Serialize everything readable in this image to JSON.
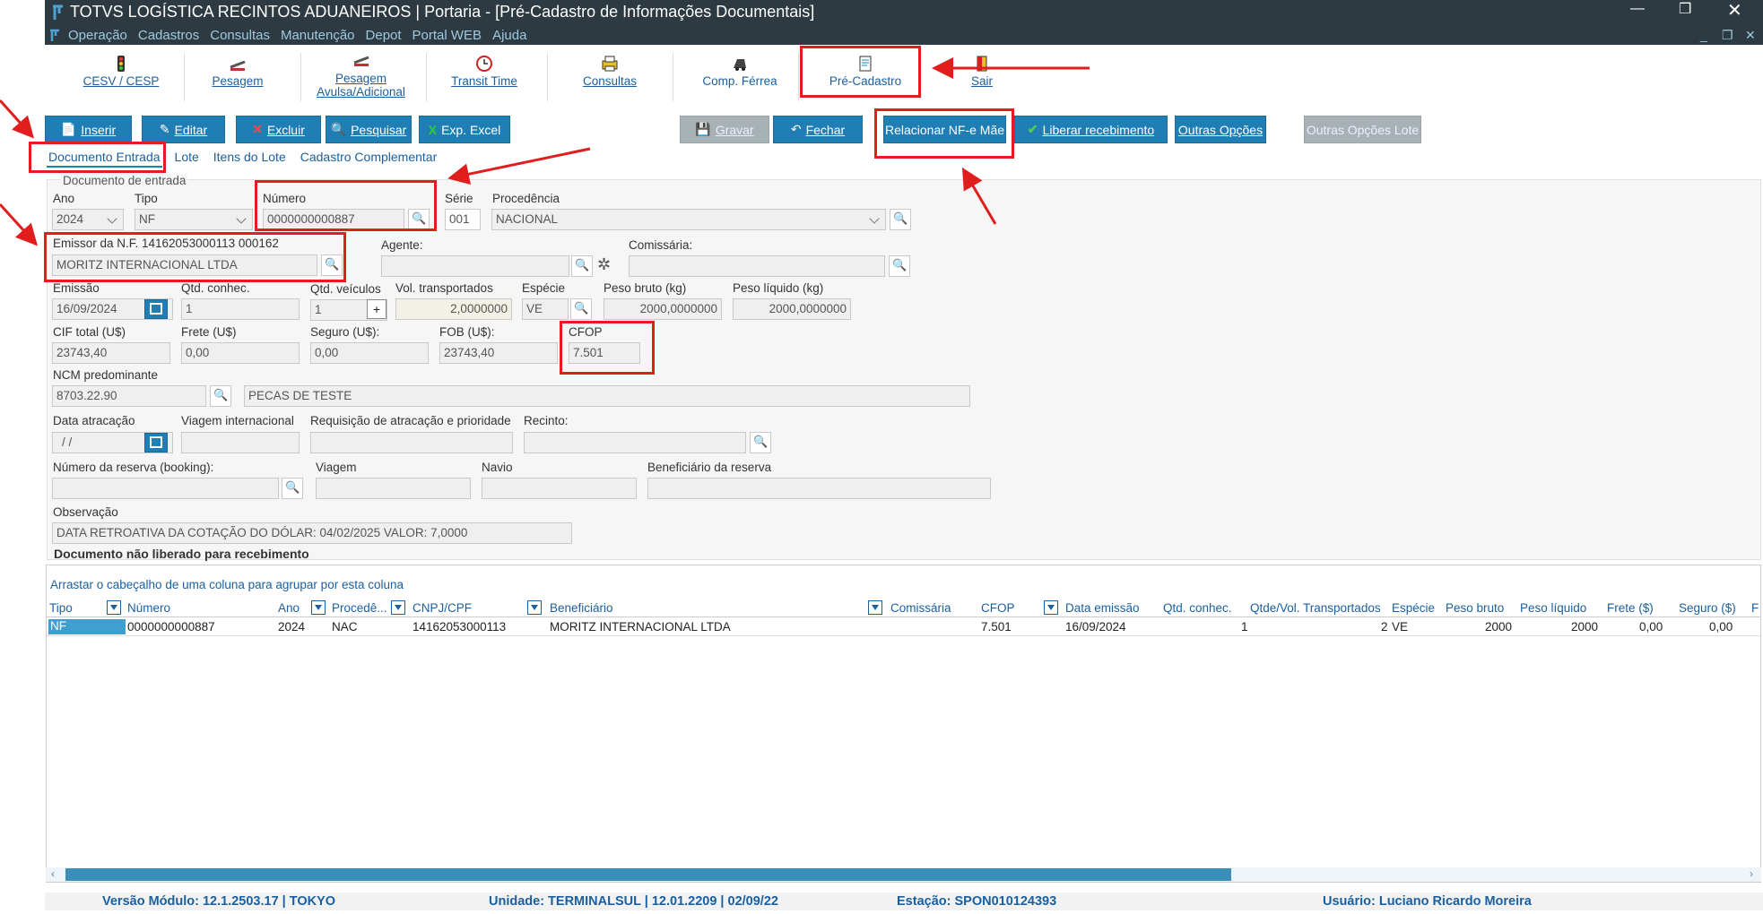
{
  "window": {
    "title": "TOTVS LOGÍSTICA RECINTOS ADUANEIROS | Portaria - [Pré-Cadastro de Informações Documentais]",
    "menu": [
      "Operação",
      "Cadastros",
      "Consultas",
      "Manutenção",
      "Depot",
      "Portal WEB",
      "Ajuda"
    ]
  },
  "toolbar": [
    {
      "label": "CESV / CESP",
      "icon": "traffic-light-icon"
    },
    {
      "label": "Pesagem",
      "icon": "scale-icon"
    },
    {
      "label": "Pesagem\nAvulsa/Adicional",
      "icon": "scale-icon"
    },
    {
      "label": "Transit Time",
      "icon": "clock-icon"
    },
    {
      "label": "Consultas",
      "icon": "printer-icon"
    },
    {
      "label": "Comp. Férrea",
      "icon": "train-icon"
    },
    {
      "label": "Pré-Cadastro",
      "icon": "document-icon"
    },
    {
      "label": "Sair",
      "icon": "exit-door-icon"
    }
  ],
  "actions": {
    "inserir": "Inserir",
    "editar": "Editar",
    "excluir": "Excluir",
    "pesquisar": "Pesquisar",
    "exp_excel": "Exp. Excel",
    "gravar": "Gravar",
    "fechar": "Fechar",
    "relacionar": "Relacionar NF-e Mãe",
    "liberar": "Liberar recebimento",
    "outras": "Outras Opções",
    "outras_lote": "Outras Opções Lote"
  },
  "tabs": [
    "Documento Entrada",
    "Lote",
    "Itens do Lote",
    "Cadastro Complementar"
  ],
  "form": {
    "group_title": "Documento de entrada",
    "ano_label": "Ano",
    "ano": "2024",
    "tipo_label": "Tipo",
    "tipo": "NF",
    "numero_label": "Número",
    "numero": "0000000000887",
    "serie_label": "Série",
    "serie": "001",
    "procedencia_label": "Procedência",
    "procedencia": "NACIONAL",
    "emissor_label": "Emissor da N.F. 14162053000113    000162",
    "emissor": "MORITZ INTERNACIONAL LTDA",
    "agente_label": "Agente:",
    "agente": "",
    "comissaria_label": "Comissária:",
    "comissaria": "",
    "emissao_label": "Emissão",
    "emissao": "16/09/2024",
    "qtd_conhec_label": "Qtd. conhec.",
    "qtd_conhec": "1",
    "qtd_veiculos_label": "Qtd. veículos",
    "qtd_veiculos": "1",
    "vol_transp_label": "Vol. transportados",
    "vol_transp": "2,0000000",
    "especie_label": "Espécie",
    "especie": "VE",
    "peso_bruto_label": "Peso bruto (kg)",
    "peso_bruto": "2000,0000000",
    "peso_liquido_label": "Peso líquido (kg)",
    "peso_liquido": "2000,0000000",
    "cif_label": "CIF total (U$)",
    "cif": "23743,40",
    "frete_label": "Frete (U$)",
    "frete": "0,00",
    "seguro_label": "Seguro (U$):",
    "seguro": "0,00",
    "fob_label": "FOB (U$):",
    "fob": "23743,40",
    "cfop_label": "CFOP",
    "cfop": "7.501",
    "ncm_label": "NCM predominante",
    "ncm": "8703.22.90",
    "ncm_desc": "PECAS DE TESTE",
    "data_atracacao_label": "Data atracação",
    "data_atracacao": "/ /",
    "viagem_int_label": "Viagem internacional",
    "requisicao_label": "Requisição de atracação e prioridade",
    "recinto_label": "Recinto:",
    "reserva_label": "Número da reserva (booking):",
    "viagem_label": "Viagem",
    "navio_label": "Navio",
    "beneficiario_label": "Beneficiário da reserva",
    "observacao_label": "Observação",
    "observacao": "DATA RETROATIVA DA COTAÇÃO DO DÓLAR: 04/02/2025 VALOR: 7,0000",
    "notice": "Documento não liberado para recebimento"
  },
  "grid": {
    "hint": "Arrastar o cabeçalho de uma coluna para agrupar por esta coluna",
    "columns": [
      "Tipo",
      "Número",
      "Ano",
      "Procedê...",
      "CNPJ/CPF",
      "Beneficiário",
      "Comissária",
      "CFOP",
      "Data emissão",
      "Qtd. conhec.",
      "Qtde/Vol. Transportados",
      "Espécie",
      "Peso bruto",
      "Peso líquido",
      "Frete ($)",
      "Seguro ($)",
      "F"
    ],
    "rows": [
      [
        "NF",
        "0000000000887",
        "2024",
        "NAC",
        "14162053000113",
        "MORITZ INTERNACIONAL LTDA",
        "",
        "7.501",
        "16/09/2024",
        "1",
        "2",
        "VE",
        "2000",
        "2000",
        "0,00",
        "0,00"
      ]
    ]
  },
  "status": {
    "versao": "Versão Módulo:  12.1.2503.17  |  TOKYO",
    "unidade": "Unidade:  TERMINALSUL | 12.01.2209 | 02/09/22",
    "estacao": "Estação:  SPON010124393",
    "usuario": "Usuário:  Luciano Ricardo Moreira"
  },
  "colors": {
    "titlebar": "#2d3a41",
    "accent": "#1f7fb4",
    "annotation": "#e11d1d"
  }
}
